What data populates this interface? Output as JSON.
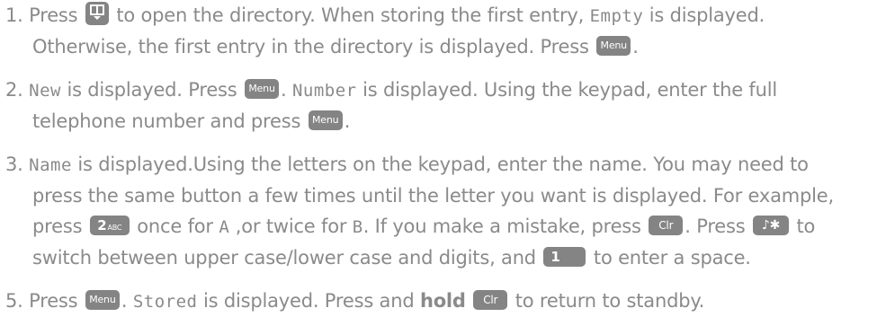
{
  "steps": [
    {
      "num": "1.",
      "line1_a": "Press",
      "line1_b": "to open the directory. When storing the first entry,",
      "line1_lcd": "Empty",
      "line1_c": "is displayed.",
      "line2_a": "Otherwise, the first entry in the directory is displayed. Press",
      "line2_key": "Menu",
      "line2_end": "."
    },
    {
      "num": "2.",
      "line1_lcd1": "New",
      "line1_a": "is displayed. Press",
      "line1_key": "Menu",
      "line1_b": ".",
      "line1_lcd2": "Number",
      "line1_c": "is displayed. Using the keypad, enter the full",
      "line2_a": "telephone number and press",
      "line2_key": "Menu",
      "line2_end": "."
    },
    {
      "num": "3.",
      "line1_lcd": "Name",
      "line1_a": "is displayed.Using the letters on the keypad, enter the name. You may need to",
      "line2": "press the same button a few times until the letter you want is displayed. For example,",
      "line3_a": "press",
      "line3_key_num": "2",
      "line3_key_sub": "ABC",
      "line3_b": "once for",
      "line3_lcd_a": "A",
      "line3_c": ",or twice for",
      "line3_lcd_b": "B",
      "line3_d": ". If you make a mistake, press",
      "line3_key_clr": "Clr",
      "line3_e": ". Press",
      "line3_key_star": "♪✱",
      "line3_f": "to",
      "line4_a": "switch between upper case/lower case and digits, and",
      "line4_key_one": "1",
      "line4_b": "to enter a space."
    },
    {
      "num": "5.",
      "line1_a": "Press",
      "line1_key": "Menu",
      "line1_b": ".",
      "line1_lcd": "Stored",
      "line1_c": "is displayed. Press and",
      "line1_bold": "hold",
      "line1_key_clr": "Clr",
      "line1_d": "to return to standby."
    }
  ],
  "icons": {
    "directory_key": "directory-book-icon"
  },
  "colors": {
    "text": "#8a8a8a",
    "key_bg": "#848484",
    "key_text": "#ffffff"
  }
}
